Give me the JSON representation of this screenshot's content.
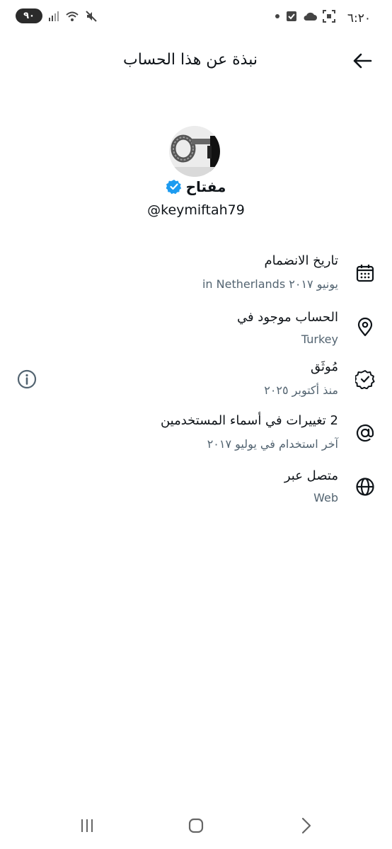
{
  "status_bar": {
    "time": "٦:٢٠",
    "battery": "٩٠",
    "icons": [
      "dot-icon",
      "check-box-icon",
      "cloud-icon",
      "screenshot-icon",
      "mute-icon",
      "wifi-icon",
      "signal-icon"
    ]
  },
  "header": {
    "title": "نبذة عن هذا الحساب",
    "back_icon": "arrow-back-icon"
  },
  "profile": {
    "display_name": "مفتاح",
    "handle": "@keymiftah79",
    "verified": true,
    "verified_color": "#1d9bf0"
  },
  "details": [
    {
      "icon": "calendar-icon",
      "title": "تاريخ الانضمام",
      "value": "يونيو ٢٠١٧ in Netherlands"
    },
    {
      "icon": "location-pin-icon",
      "title": "الحساب موجود في",
      "value": "Turkey"
    },
    {
      "icon": "verified-badge-icon",
      "title": "مُوثَق",
      "value": "منذ أكتوبر ٢٠٢٥"
    },
    {
      "icon": "at-sign-icon",
      "title": "2 تغييرات في أسماء المستخدمين",
      "value": "آخر استخدام في يوليو ٢٠١٧"
    },
    {
      "icon": "globe-icon",
      "title": "متصل عبر",
      "value": "Web"
    }
  ],
  "nav": [
    "recents-icon",
    "home-icon",
    "back-icon"
  ]
}
